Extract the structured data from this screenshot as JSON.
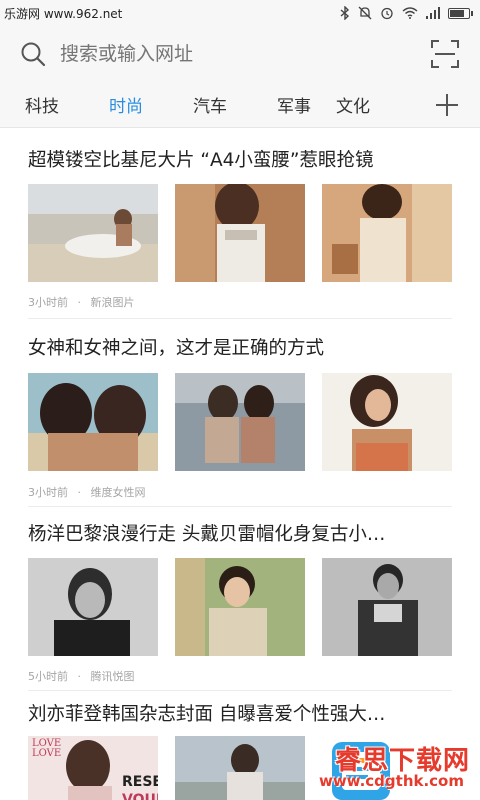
{
  "status_bar": {
    "watermark": "乐游网 www.962.net",
    "icons": [
      "bluetooth-icon",
      "mute-icon",
      "alarm-icon",
      "wifi-icon",
      "signal-icon",
      "battery-icon"
    ],
    "battery_level": 0.85
  },
  "search": {
    "placeholder": "搜索或输入网址"
  },
  "tabs": {
    "items": [
      "科技",
      "时尚",
      "汽车",
      "军事",
      "文化"
    ],
    "active_index": 1,
    "accent_color": "#2a8ee0"
  },
  "feed": {
    "articles": [
      {
        "title": "超模镂空比基尼大片 “A4小蛮腰”惹眼抢镜",
        "time": "3小时前",
        "source": "新浪图片"
      },
      {
        "title": "女神和女神之间，这才是正确的方式",
        "time": "3小时前",
        "source": "维度女性网"
      },
      {
        "title": "杨洋巴黎浪漫行走 头戴贝雷帽化身复古小…",
        "time": "5小时前",
        "source": "腾讯悦图"
      },
      {
        "title": "刘亦菲登韩国杂志封面 自曝喜爱个性强大…",
        "time": "",
        "source": ""
      }
    ],
    "separator": "·",
    "magazine_text": [
      "LOVE",
      "LOVE",
      "RESET",
      "VOUI"
    ]
  },
  "watermark_bottom": {
    "cn": "睿思下载网",
    "en": "www.cdgthk.com"
  }
}
